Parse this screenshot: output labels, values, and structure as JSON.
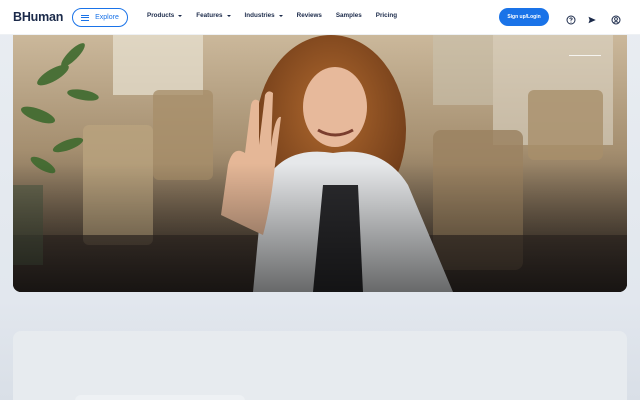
{
  "header": {
    "logo": "BHuman",
    "explore_label": "Explore",
    "nav": [
      {
        "label": "Products",
        "dropdown": true
      },
      {
        "label": "Features",
        "dropdown": true
      },
      {
        "label": "Industries",
        "dropdown": true
      },
      {
        "label": "Reviews",
        "dropdown": false
      },
      {
        "label": "Samples",
        "dropdown": false
      },
      {
        "label": "Pricing",
        "dropdown": false
      }
    ],
    "signup_label": "Sign up/Login",
    "icons": [
      "help-circle-icon",
      "send-icon",
      "user-icon"
    ]
  },
  "colors": {
    "accent": "#1a73e8",
    "text": "#1b2a4a",
    "background": "#e5e9ee"
  },
  "hero": {
    "image": "woman waving at laptop in cafe"
  }
}
